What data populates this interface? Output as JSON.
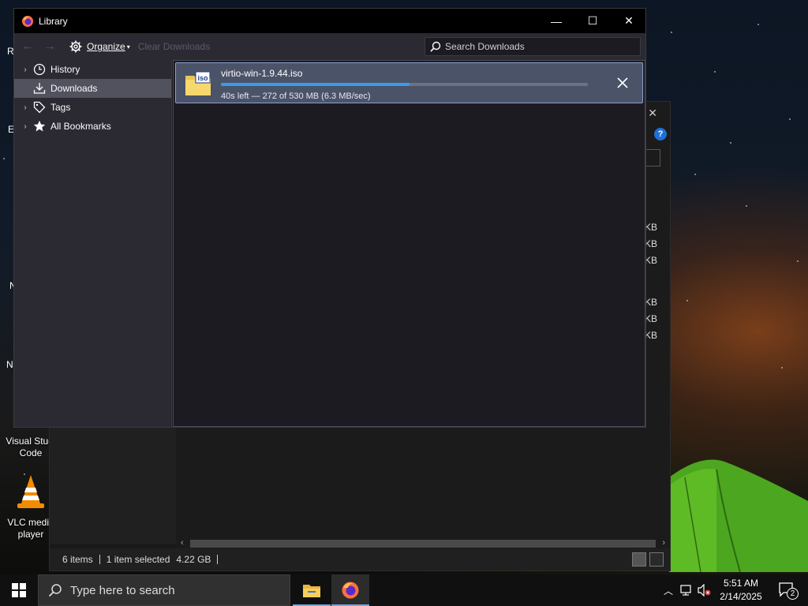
{
  "library": {
    "title": "Library",
    "window_controls": {
      "minimize": "—",
      "maximize": "☐",
      "close": "✕"
    },
    "toolbar": {
      "back": "←",
      "forward": "→",
      "organize_label": "Organize",
      "clear_downloads_label": "Clear Downloads",
      "search_placeholder": "Search Downloads"
    },
    "sidebar": {
      "items": [
        {
          "label": "History",
          "icon": "clock-icon",
          "has_twisty": true
        },
        {
          "label": "Downloads",
          "icon": "download-icon",
          "has_twisty": false,
          "selected": true
        },
        {
          "label": "Tags",
          "icon": "tag-icon",
          "has_twisty": true
        },
        {
          "label": "All Bookmarks",
          "icon": "star-icon",
          "has_twisty": true
        }
      ]
    },
    "downloads": [
      {
        "filename": "virtio-win-1.9.44.iso",
        "status": "40s left — 272 of 530 MB (6.3 MB/sec)",
        "progress": 0.513,
        "file_icon_label": "iso"
      }
    ]
  },
  "explorer": {
    "status_items": "6 items",
    "status_selected": "1 item selected",
    "status_size": "4.22 GB",
    "size_column": [
      "KB",
      "KB",
      "KB",
      "KB",
      "KB",
      "KB"
    ]
  },
  "desktop": {
    "icons": [
      {
        "label": "Visual Studio Code",
        "short": "Visual Studi\nCode"
      },
      {
        "label": "VLC media player",
        "short": "VLC media\nplayer"
      }
    ],
    "partial_letters": [
      "R",
      "E",
      "N",
      "N"
    ]
  },
  "taskbar": {
    "search_placeholder": "Type here to search",
    "time": "5:51 AM",
    "date": "2/14/2025",
    "notifications_count": "2"
  },
  "colors": {
    "progress_fill": "#3b9ce8",
    "selected_row": "#4b5369",
    "sidebar_selected": "#52525e"
  }
}
